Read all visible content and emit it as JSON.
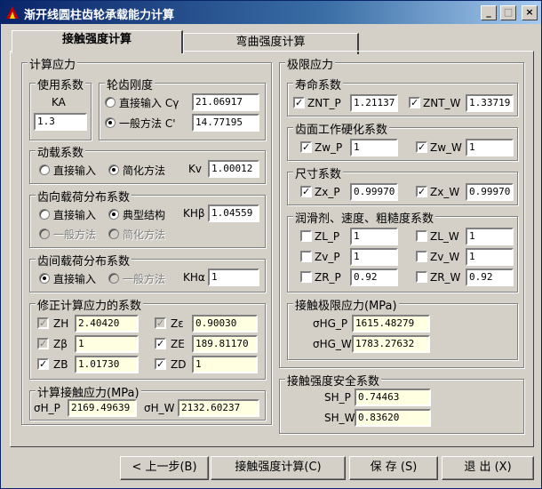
{
  "window": {
    "title": "渐开线圆柱齿轮承载能力计算"
  },
  "tabs": [
    "接触强度计算",
    "弯曲强度计算"
  ],
  "calc_stress": {
    "title": "计算应力",
    "usage": {
      "title": "使用系数",
      "label": "KA",
      "value": "1.3"
    },
    "stiffness": {
      "title": "轮齿刚度",
      "direct_label": "直接输入 Cγ",
      "direct_value": "21.06917",
      "general_label": "一般方法  C'",
      "general_value": "14.77195"
    },
    "dynamic": {
      "title": "动载系数",
      "opt1": "直接输入",
      "opt2": "简化方法",
      "label": "Kv",
      "value": "1.00012"
    },
    "face_load": {
      "title": "齿向载荷分布系数",
      "opt1": "直接输入",
      "opt2": "典型结构",
      "label": "KHβ",
      "value": "1.04559",
      "opt3": "一般方法",
      "opt4": "简化方法"
    },
    "transverse_load": {
      "title": "齿间载荷分布系数",
      "opt1": "直接输入",
      "opt2": "一般方法",
      "label": "KHα",
      "value": "1"
    },
    "correction": {
      "title": "修正计算应力的系数",
      "zh_label": "ZH",
      "zh_value": "2.40420",
      "ze_eps_label": "Zε",
      "ze_eps_value": "0.90030",
      "zb_beta_label": "Zβ",
      "zb_beta_value": "1",
      "ze_label": "ZE",
      "ze_value": "189.81170",
      "zb_label": "ZB",
      "zb_value": "1.01730",
      "zd_label": "ZD",
      "zd_value": "1"
    },
    "contact_stress": {
      "title": "计算接触应力(MPa)",
      "p_label": "σH_P",
      "p_value": "2169.49639",
      "w_label": "σH_W",
      "w_value": "2132.60237"
    }
  },
  "limit_stress": {
    "title": "极限应力",
    "life": {
      "title": "寿命系数",
      "p_label": "ZNT_P",
      "p_value": "1.21137",
      "w_label": "ZNT_W",
      "w_value": "1.33719"
    },
    "hardening": {
      "title": "齿面工作硬化系数",
      "p_label": "Zw_P",
      "p_value": "1",
      "w_label": "Zw_W",
      "w_value": "1"
    },
    "size": {
      "title": "尺寸系数",
      "p_label": "Zx_P",
      "p_value": "0.99970",
      "w_label": "Zx_W",
      "w_value": "0.99970"
    },
    "lubrication": {
      "title": "润滑剂、速度、粗糙度系数",
      "zl_p_label": "ZL_P",
      "zl_p_value": "1",
      "zl_w_label": "ZL_W",
      "zl_w_value": "1",
      "zv_p_label": "Zv_P",
      "zv_p_value": "1",
      "zv_w_label": "Zv_W",
      "zv_w_value": "1",
      "zr_p_label": "ZR_P",
      "zr_p_value": "0.92",
      "zr_w_label": "ZR_W",
      "zr_w_value": "0.92"
    },
    "contact_limit": {
      "title": "接触极限应力(MPa)",
      "p_label": "σHG_P",
      "p_value": "1615.48279",
      "w_label": "σHG_W",
      "w_value": "1783.27632"
    }
  },
  "safety": {
    "title": "接触强度安全系数",
    "p_label": "SH_P",
    "p_value": "0.74463",
    "w_label": "SH_W",
    "w_value": "0.83620"
  },
  "buttons": {
    "prev": "< 上一步(B)",
    "calc": "接触强度计算(C)",
    "save": "保  存 (S)",
    "exit": "退  出 (X)"
  }
}
